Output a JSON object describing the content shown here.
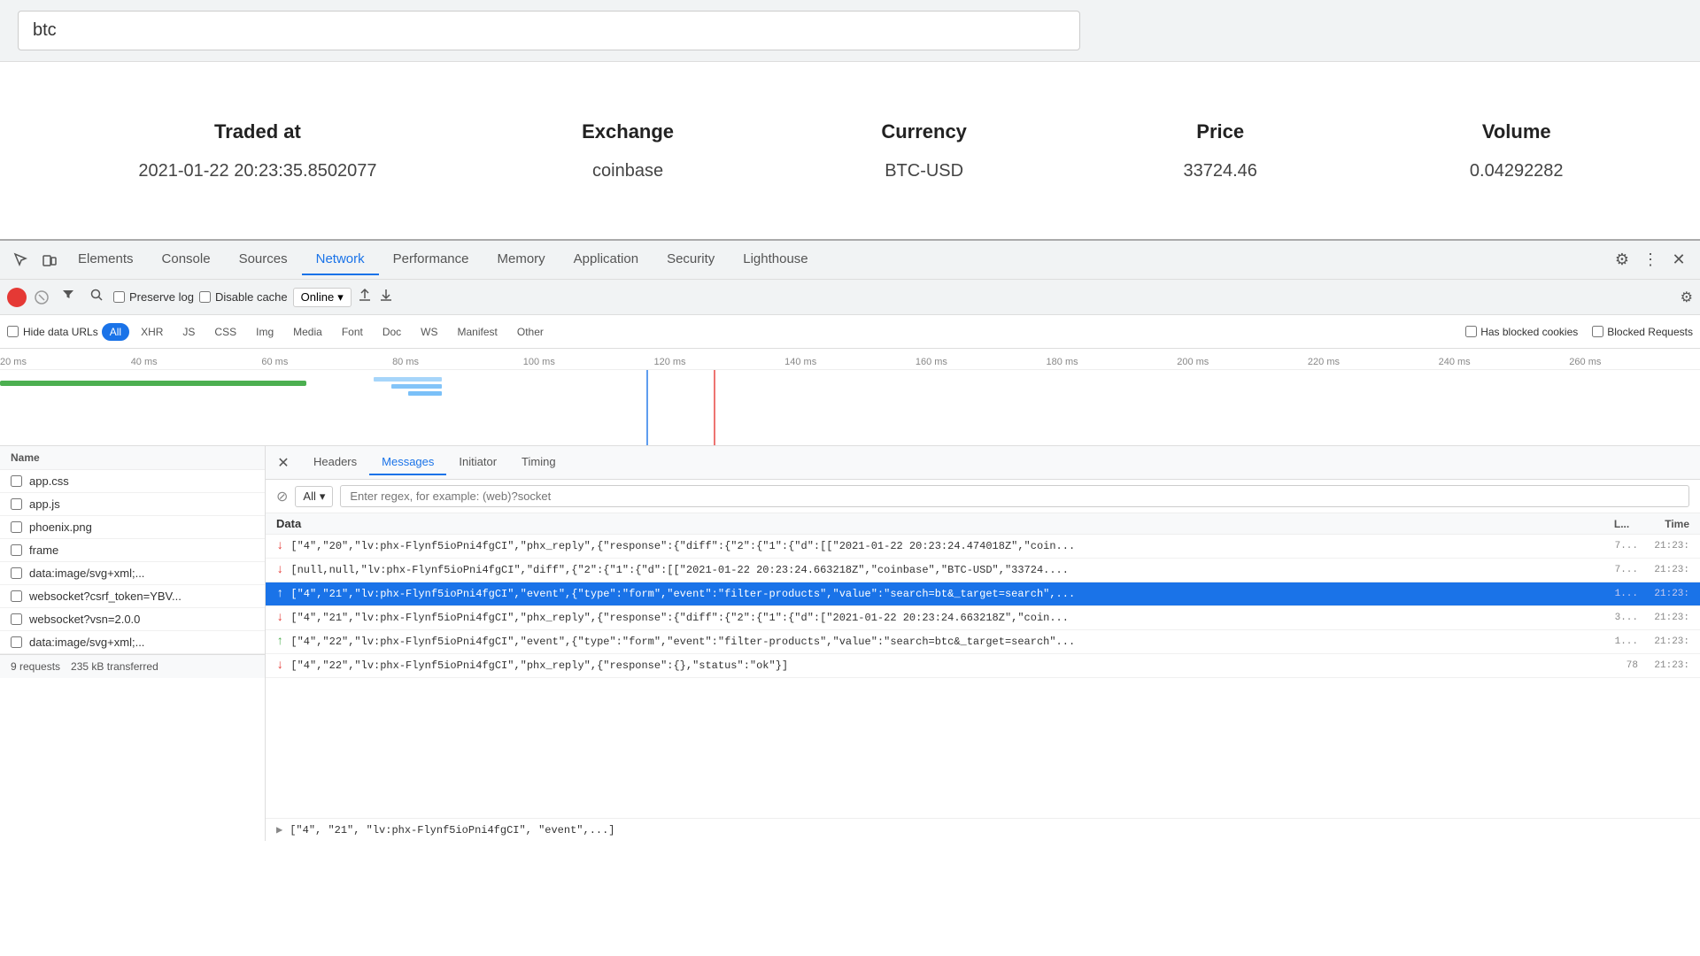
{
  "browser": {
    "address": "btc"
  },
  "page": {
    "table_headers": [
      "Traded at",
      "Exchange",
      "Currency",
      "Price",
      "Volume"
    ],
    "table_row": {
      "traded_at": "2021-01-22 20:23:35.8502077",
      "exchange": "coinbase",
      "currency": "BTC-USD",
      "price": "33724.46",
      "volume": "0.04292282"
    }
  },
  "devtools": {
    "tabs": [
      {
        "label": "Elements",
        "active": false
      },
      {
        "label": "Console",
        "active": false
      },
      {
        "label": "Sources",
        "active": false
      },
      {
        "label": "Network",
        "active": true
      },
      {
        "label": "Performance",
        "active": false
      },
      {
        "label": "Memory",
        "active": false
      },
      {
        "label": "Application",
        "active": false
      },
      {
        "label": "Security",
        "active": false
      },
      {
        "label": "Lighthouse",
        "active": false
      }
    ]
  },
  "network": {
    "toolbar": {
      "preserve_log_label": "Preserve log",
      "disable_cache_label": "Disable cache",
      "online_label": "Online"
    },
    "filter_bar": {
      "filter_placeholder": "Filter",
      "hide_data_urls_label": "Hide data URLs",
      "chips": [
        "All",
        "XHR",
        "JS",
        "CSS",
        "Img",
        "Media",
        "Font",
        "Doc",
        "WS",
        "Manifest",
        "Other"
      ],
      "active_chip": "All",
      "has_blocked_cookies_label": "Has blocked cookies",
      "blocked_requests_label": "Blocked Requests"
    },
    "timeline": {
      "ticks": [
        "20 ms",
        "40 ms",
        "60 ms",
        "80 ms",
        "100 ms",
        "120 ms",
        "140 ms",
        "160 ms",
        "180 ms",
        "200 ms",
        "220 ms",
        "240 ms",
        "260 ms"
      ]
    },
    "files": [
      {
        "name": "app.css",
        "checked": false
      },
      {
        "name": "app.js",
        "checked": false
      },
      {
        "name": "phoenix.png",
        "checked": false
      },
      {
        "name": "frame",
        "checked": false
      },
      {
        "name": "data:image/svg+xml;...",
        "checked": false
      },
      {
        "name": "websocket?csrf_token=YBV...",
        "checked": false
      },
      {
        "name": "websocket?vsn=2.0.0",
        "checked": false
      },
      {
        "name": "data:image/svg+xml;...",
        "checked": false
      }
    ],
    "footer": {
      "requests": "9 requests",
      "transferred": "235 kB transferred"
    }
  },
  "detail": {
    "tabs": [
      "Headers",
      "Messages",
      "Initiator",
      "Timing"
    ],
    "active_tab": "Messages",
    "filter": {
      "block_icon": "⊘",
      "all_label": "All",
      "placeholder": "Enter regex, for example: (web)?socket"
    },
    "data_section": {
      "header": "Data",
      "col_l": "L...",
      "col_time": "Time"
    },
    "rows": [
      {
        "direction": "down",
        "content": "[\"4\",\"20\",\"lv:phx-Flynf5ioPni4fgCI\",\"phx_reply\",{\"response\":{\"diff\":{\"2\":{\"1\":{\"d\":[[\"2021-01-22 20:23:24.474018Z\",\"coin...",
        "l": "7...",
        "time": "21:23:",
        "selected": false
      },
      {
        "direction": "down",
        "content": "[null,null,\"lv:phx-Flynf5ioPni4fgCI\",\"diff\",{\"2\":{\"1\":{\"d\":[[\"2021-01-22 20:23:24.663218Z\",\"coinbase\",\"BTC-USD\",\"33724....",
        "l": "7...",
        "time": "21:23:",
        "selected": false
      },
      {
        "direction": "up",
        "content": "[\"4\",\"21\",\"lv:phx-Flynf5ioPni4fgCI\",\"event\",{\"type\":\"form\",\"event\":\"filter-products\",\"value\":\"search=bt&_target=search\",...",
        "l": "1...",
        "time": "21:23:",
        "selected": true
      },
      {
        "direction": "down",
        "content": "[\"4\",\"21\",\"lv:phx-Flynf5ioPni4fgCI\",\"phx_reply\",{\"response\":{\"diff\":{\"2\":{\"1\":{\"d\":[\"2021-01-22 20:23:24.663218Z\",\"coin...",
        "l": "3...",
        "time": "21:23:",
        "selected": false
      },
      {
        "direction": "up",
        "content": "[\"4\",\"22\",\"lv:phx-Flynf5ioPni4fgCI\",\"event\",{\"type\":\"form\",\"event\":\"filter-products\",\"value\":\"search=btc&_target=search\"...",
        "l": "1...",
        "time": "21:23:",
        "selected": false
      },
      {
        "direction": "down",
        "content": "[\"4\",\"22\",\"lv:phx-Flynf5ioPni4fgCI\",\"phx_reply\",{\"response\":{},\"status\":\"ok\"}]",
        "l": "78",
        "time": "21:23:",
        "selected": false
      }
    ],
    "expand_row": "[\"4\", \"21\", \"lv:phx-Flynf5ioPni4fgCI\", \"event\",...]"
  }
}
